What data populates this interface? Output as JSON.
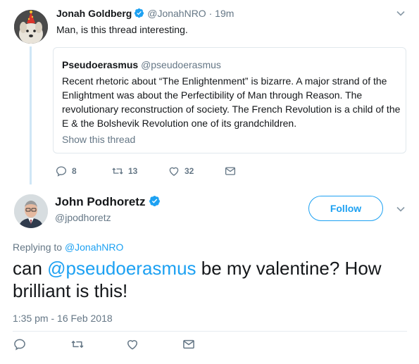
{
  "tweet1": {
    "author_name": "Jonah Goldberg",
    "handle": "@JonahNRO",
    "separator": "·",
    "time": "19m",
    "text": "Man, is this thread interesting.",
    "quote": {
      "author_name": "Pseudoerasmus",
      "handle": "@pseudoerasmus",
      "text": "Recent rhetoric about “The Enlightenment” is bizarre. A major strand of the Enlightment was about the Perfectibility of Man through Reason. The revolutionary reconstruction of society. The French Revolution is a child of the E & the Bolshevik Revolution one of its grandchildren.",
      "show_thread": "Show this thread"
    },
    "actions": {
      "reply_count": "8",
      "retweet_count": "13",
      "like_count": "32"
    }
  },
  "tweet2": {
    "author_name": "John Podhoretz",
    "handle": "@jpodhoretz",
    "follow_label": "Follow",
    "replying_prefix": "Replying to",
    "replying_handle": "@JonahNRO",
    "text_before": "can ",
    "text_mention": "@pseudoerasmus",
    "text_after": " be my valentine? How brilliant is this!",
    "timestamp": "1:35 pm - 16 Feb 2018"
  },
  "icons": {
    "verified": "verified-badge-icon",
    "caret": "chevron-down-icon",
    "reply": "reply-icon",
    "retweet": "retweet-icon",
    "like": "heart-icon",
    "dm": "envelope-icon"
  },
  "colors": {
    "accent": "#1da1f2",
    "muted": "#657786",
    "text": "#14171a",
    "thread_line": "#cfe6f6"
  }
}
